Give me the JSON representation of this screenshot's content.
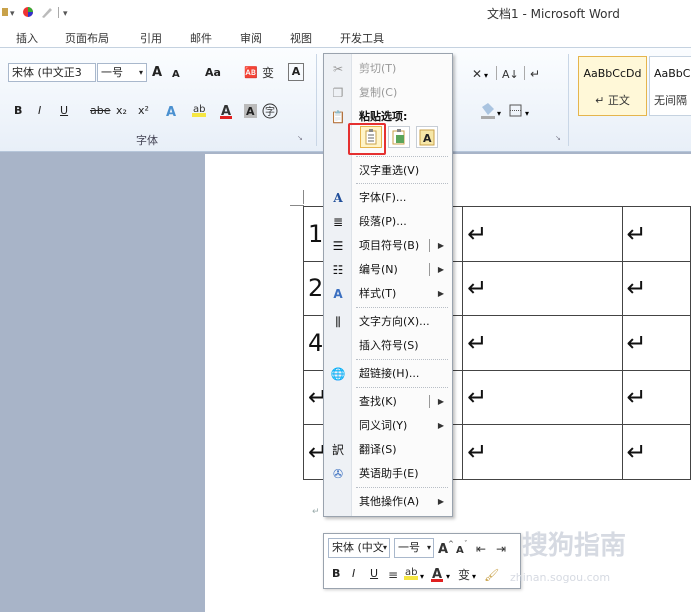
{
  "window": {
    "title": "文档1 - Microsoft Word"
  },
  "tabs": [
    "插入",
    "页面布局",
    "引用",
    "邮件",
    "审阅",
    "视图",
    "开发工具"
  ],
  "ribbon": {
    "font_name": "宋体 (中文正3",
    "font_size": "一号",
    "grow_font": "A",
    "shrink_font": "A",
    "change_case": "Aa",
    "bold": "B",
    "italic": "I",
    "underline": "U",
    "strikethrough": "abe",
    "subscript": "x₂",
    "superscript": "x²",
    "font_group_label": "字体",
    "styles": [
      {
        "preview": "AaBbCcDd",
        "name": "↵ 正文",
        "selected": true
      },
      {
        "preview": "AaBbC",
        "name": "无间隔",
        "selected": false
      }
    ]
  },
  "document": {
    "table": [
      [
        "1",
        "↵",
        "↵",
        "↵"
      ],
      [
        "2",
        "↵",
        "↵",
        "↵"
      ],
      [
        "4",
        "↵",
        "↵",
        "↵"
      ],
      [
        "↵",
        "↵",
        "↵",
        "↵"
      ],
      [
        "↵",
        "↵",
        "↵",
        "↵"
      ]
    ],
    "paragraph_mark": "↵"
  },
  "context_menu": {
    "items": [
      {
        "label": "剪切(T)",
        "icon": "scissors-icon",
        "disabled": true
      },
      {
        "label": "复制(C)",
        "icon": "copy-icon",
        "disabled": true
      },
      {
        "label": "粘贴选项:",
        "icon": "clipboard-icon",
        "header": true
      },
      {
        "label": "汉字重选(V)",
        "icon": ""
      },
      {
        "label": "字体(F)...",
        "icon": "font-icon"
      },
      {
        "label": "段落(P)...",
        "icon": "paragraph-icon"
      },
      {
        "label": "项目符号(B)",
        "icon": "bullets-icon",
        "submenu": true
      },
      {
        "label": "编号(N)",
        "icon": "numbering-icon",
        "submenu": true
      },
      {
        "label": "样式(T)",
        "icon": "styles-icon",
        "submenu": true
      },
      {
        "label": "文字方向(X)...",
        "icon": "text-direction-icon"
      },
      {
        "label": "插入符号(S)",
        "icon": ""
      },
      {
        "label": "超链接(H)...",
        "icon": "hyperlink-icon"
      },
      {
        "label": "查找(K)",
        "icon": "",
        "submenu": true
      },
      {
        "label": "同义词(Y)",
        "icon": "",
        "submenu": true
      },
      {
        "label": "翻译(S)",
        "icon": "translate-icon"
      },
      {
        "label": "英语助手(E)",
        "icon": "english-assistant-icon"
      },
      {
        "label": "其他操作(A)",
        "icon": "",
        "submenu": true
      }
    ],
    "paste_options": [
      "keep-source-formatting-icon",
      "merge-formatting-icon",
      "keep-text-only-icon"
    ]
  },
  "mini_toolbar": {
    "font_name": "宋体 (中文",
    "font_size": "一号"
  },
  "watermark": {
    "text": "搜狗指南",
    "sub": "zhinan.sogou.com"
  },
  "colors": {
    "accent_red": "#e02020",
    "highlight_yellow": "#f5e642",
    "selection_box": "#e53030"
  }
}
